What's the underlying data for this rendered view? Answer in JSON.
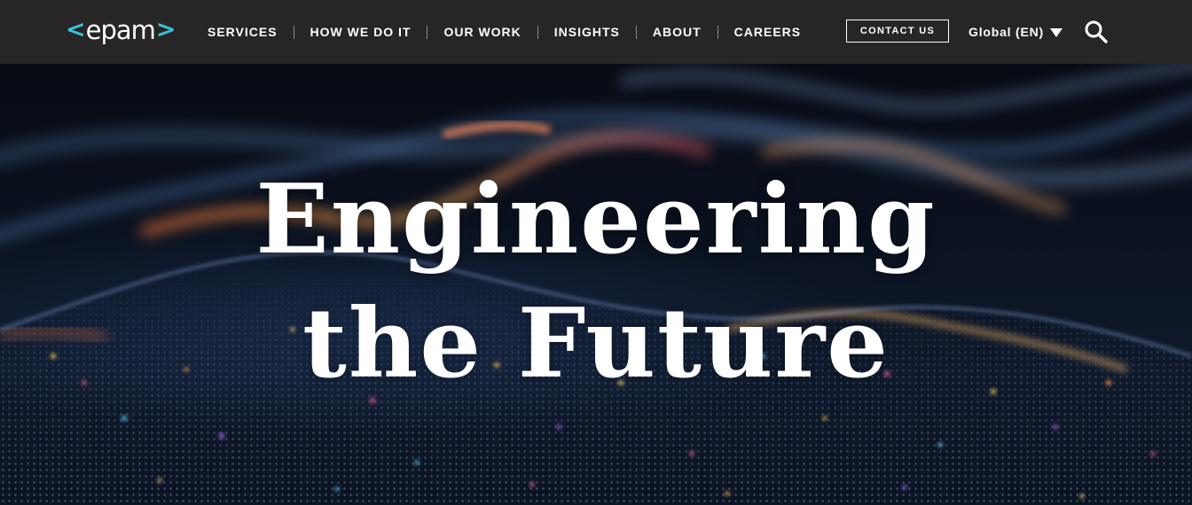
{
  "brand": {
    "logo_text": "epam",
    "logo_bracket_left": "<",
    "logo_bracket_right": ">",
    "accent_color": "#39c2d7"
  },
  "header": {
    "background": "#272526",
    "nav": [
      {
        "label": "SERVICES"
      },
      {
        "label": "HOW WE DO IT"
      },
      {
        "label": "OUR WORK"
      },
      {
        "label": "INSIGHTS"
      },
      {
        "label": "ABOUT"
      },
      {
        "label": "CAREERS"
      }
    ],
    "contact_label": "CONTACT US",
    "language_label": "Global (EN)",
    "language_icon": "chevron-down-icon",
    "search_icon": "search-icon"
  },
  "hero": {
    "title_line1": "Engineering",
    "title_line2": "the Future"
  }
}
